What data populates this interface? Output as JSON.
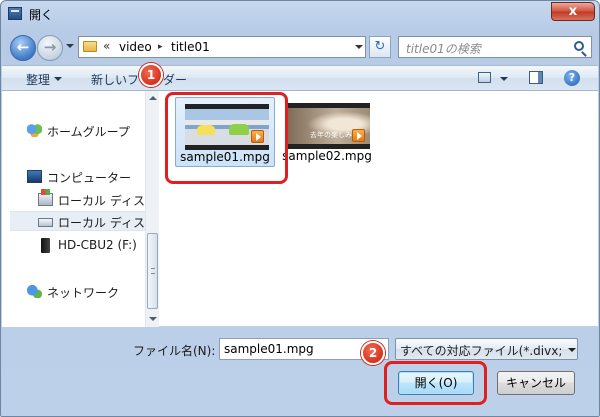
{
  "window": {
    "title": "開く",
    "close_label": "x"
  },
  "address": {
    "chevrons": "«",
    "segments": [
      "video",
      "title01"
    ],
    "separator": "▸"
  },
  "search": {
    "placeholder": "title01の検索"
  },
  "toolbar": {
    "organize": "整理",
    "new_folder": "新しいフォルダー",
    "help": "?"
  },
  "nav": {
    "items": [
      {
        "label": "ホームグループ",
        "icon": "homegroup-icon"
      },
      {
        "label": "コンピューター",
        "icon": "computer-icon"
      },
      {
        "label": "ローカル ディス",
        "icon": "system-drive-icon"
      },
      {
        "label": "ローカル ディス",
        "icon": "drive-icon"
      },
      {
        "label": "HD-CBU2 (F:)",
        "icon": "usb-drive-icon"
      },
      {
        "label": "ネットワーク",
        "icon": "network-icon"
      }
    ]
  },
  "files": [
    {
      "name": "sample01.mpg",
      "selected": true
    },
    {
      "name": "sample02.mpg",
      "selected": false,
      "thumb_caption": "去年の楽しみは"
    }
  ],
  "bottom": {
    "filename_label": "ファイル名(N):",
    "filename_value": "sample01.mpg",
    "filter_value": "すべての対応ファイル(*.divx;",
    "open_button": "開く(O)",
    "cancel_button": "キャンセル"
  },
  "annotations": {
    "badge1": "1",
    "badge2": "2",
    "highlight_color": "#e02020"
  }
}
